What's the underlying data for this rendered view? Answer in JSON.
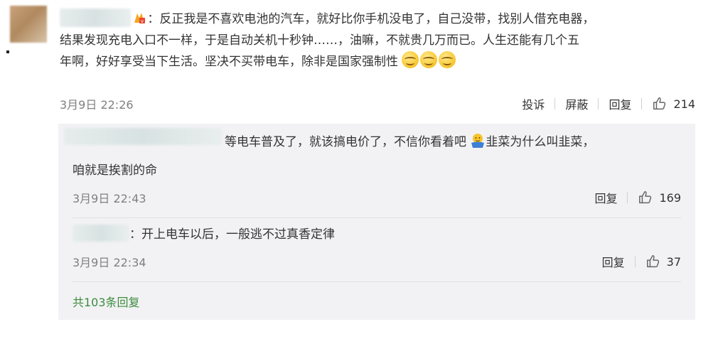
{
  "comment": {
    "text_line1": "：反正我是不喜欢电池的汽车，就好比你手机没电了，自己没带，找别人借充电器，",
    "text_line2": "结果发现充电入口不一样，于是自动关机十秒钟……，油嘛，不就贵几万而已。人生还能有几个五",
    "text_line3": "年啊，好好享受当下生活。坚决不买带电车，除非是国家强制性",
    "time": "3月9日 22:26",
    "actions": {
      "report": "投诉",
      "block": "屏蔽",
      "reply": "回复",
      "likes": "214"
    }
  },
  "replies": [
    {
      "text_line1": "等电车普及了，就该搞电价了，不信你看着吧",
      "text_line1b": "韭菜为什么叫韭菜，",
      "text_line2": "咱就是挨割的命",
      "time": "3月9日 22:43",
      "reply_label": "回复",
      "likes": "169"
    },
    {
      "text": "：开上电车以后，一般逃不过真香定律",
      "time": "3月9日 22:34",
      "reply_label": "回复",
      "likes": "37"
    }
  ],
  "more_replies": "共103条回复",
  "colors": {
    "panel_bg": "#f2f2f5",
    "link_green": "#3b8c3b",
    "meta_gray": "#808080"
  },
  "icons": [
    "vip-badge-icon",
    "smile-emoji-icon",
    "shrug-emoji-icon",
    "thumbs-up-icon"
  ]
}
